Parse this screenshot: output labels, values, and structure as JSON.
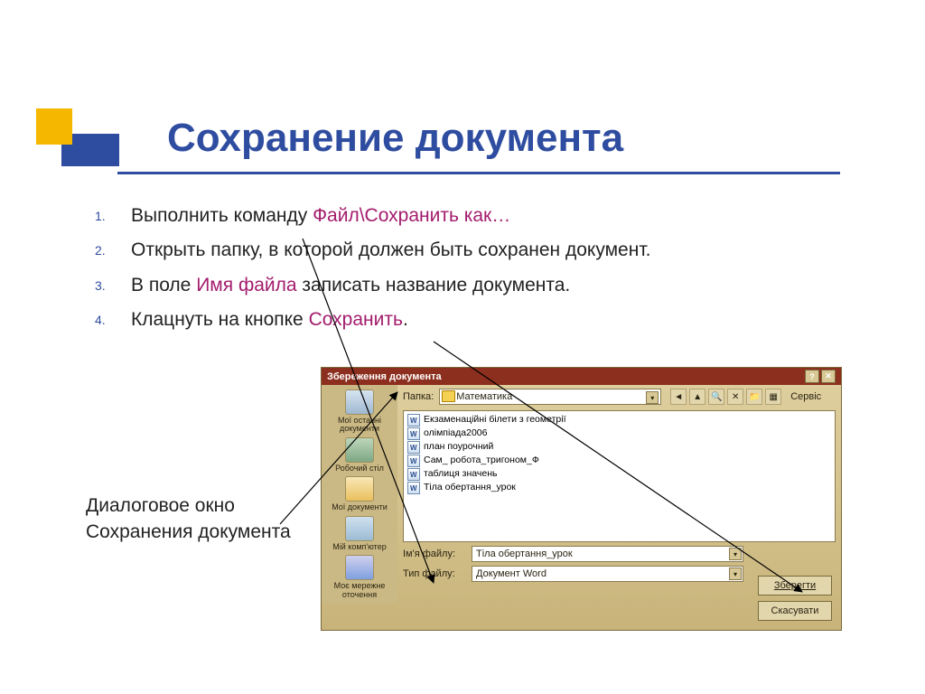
{
  "title": "Сохранение документа",
  "list": {
    "n1": "1.",
    "i1a": "Выполнить команду ",
    "i1b": "Файл\\Сохранить как…",
    "n2": "2.",
    "i2": "Открыть папку, в которой должен быть сохранен документ.",
    "n3": "3.",
    "i3a": "В поле ",
    "i3b": "Имя файла",
    "i3c": " записать название документа.",
    "n4": "4.",
    "i4a": "Клацнуть на кнопке ",
    "i4b": "Сохранить",
    "i4c": "."
  },
  "caption1": "Диалоговое окно",
  "caption2": "Сохранения документа",
  "dialog": {
    "title": "Збереження документа",
    "folder_label": "Папка:",
    "folder_value": "Математика",
    "service": "Сервіс",
    "sidebar": {
      "s1": "Мої останні документи",
      "s2": "Робочий стіл",
      "s3": "Мої документи",
      "s4": "Мій комп'ютер",
      "s5": "Моє мережне оточення"
    },
    "files": {
      "f1": "Екзаменаційні білети з геометрії",
      "f2": "олімпіада2006",
      "f3": "план поурочний",
      "f4": "Сам_ робота_тригоном_Ф",
      "f5": "таблиця значень",
      "f6": "Тіла обертання_урок"
    },
    "fname_label": "Ім'я файлу:",
    "fname_value": "Тіла обертання_урок",
    "ftype_label": "Тип файлу:",
    "ftype_value": "Документ Word",
    "save": "Зберегти",
    "cancel": "Скасувати"
  }
}
